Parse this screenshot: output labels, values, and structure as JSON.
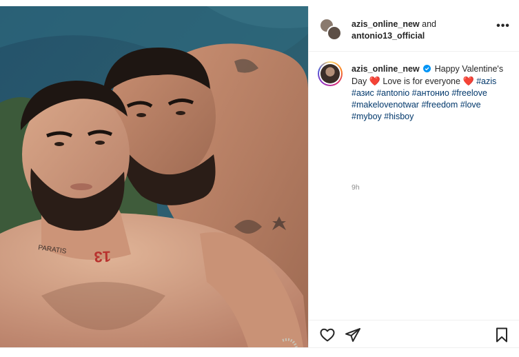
{
  "post": {
    "header": {
      "user1": "azis_online_new",
      "joiner": "and",
      "user2": "antonio13_official",
      "more_icon": "more-options-icon"
    },
    "caption": {
      "username": "azis_online_new",
      "verified": true,
      "text_part1": "Happy Valentine's Day",
      "heart1": "❤️",
      "text_part2": "Love is for everyone",
      "heart2": "❤️",
      "hashtags": [
        "#azis",
        "#азис",
        "#antonio",
        "#антонио",
        "#freelove",
        "#makelovenotwar",
        "#freedom",
        "#love",
        "#myboy",
        "#hisboy"
      ],
      "time": "9h"
    },
    "actions": {
      "like_icon": "heart-outline-icon",
      "share_icon": "paper-plane-icon",
      "save_icon": "bookmark-icon"
    },
    "photo": {
      "neck_tattoo_number": "13",
      "neck_tattoo_word": "PARATIS"
    },
    "colors": {
      "link": "#00376b",
      "heart": "#e0245e",
      "verified": "#0095f6",
      "muted": "#8e8e8e"
    }
  }
}
